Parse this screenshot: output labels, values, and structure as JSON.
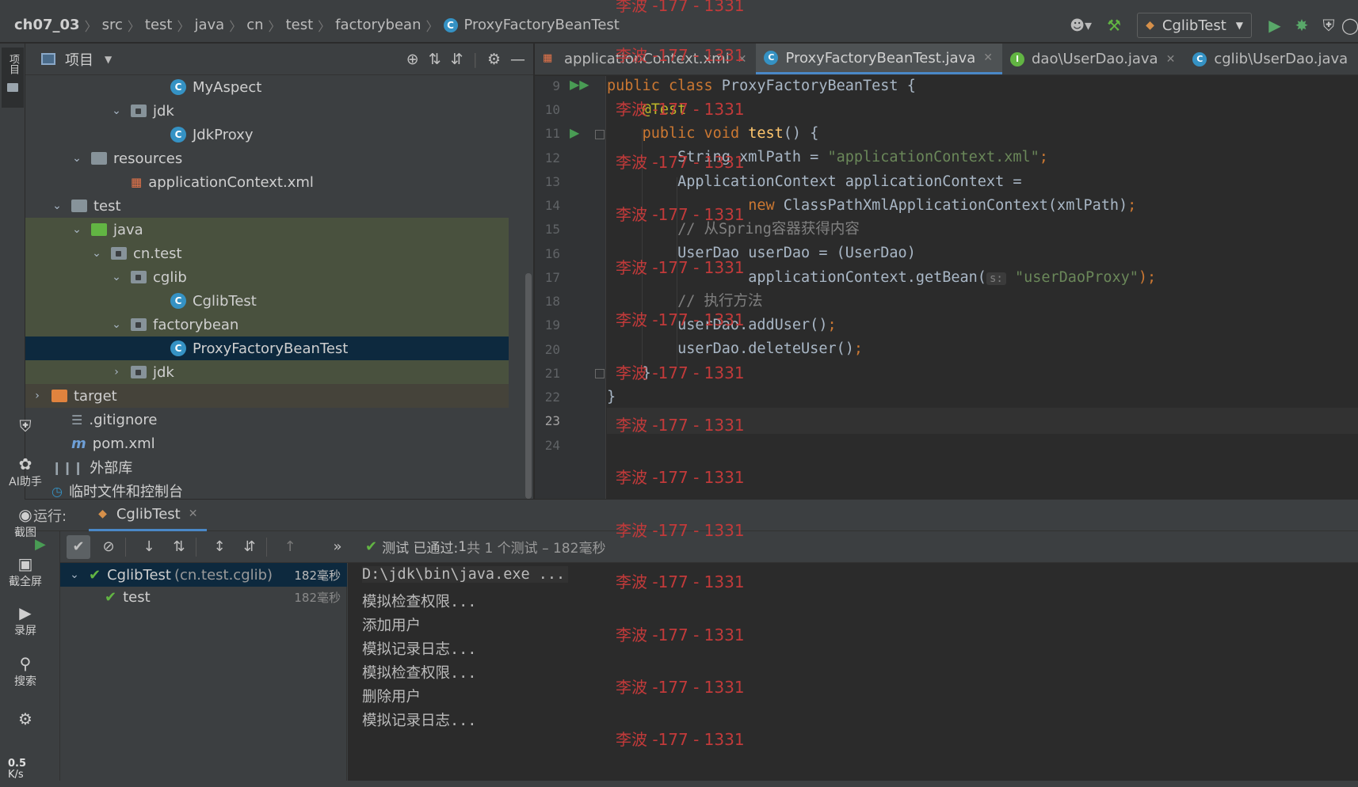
{
  "navbar": {
    "breadcrumbs": [
      "ch07_03",
      "src",
      "test",
      "java",
      "cn",
      "test",
      "factorybean",
      "ProxyFactoryBeanTest"
    ],
    "run_config": "CglibTest"
  },
  "left_strip": {
    "project_tab": "项目"
  },
  "project_panel": {
    "title": "项目",
    "tree": [
      {
        "label": "MyAspect",
        "type": "class",
        "depth": 7
      },
      {
        "label": "jdk",
        "type": "package",
        "depth": 5,
        "open": true
      },
      {
        "label": "JdkProxy",
        "type": "class",
        "depth": 7
      },
      {
        "label": "resources",
        "type": "resources",
        "depth": 3,
        "open": true
      },
      {
        "label": "applicationContext.xml",
        "type": "xml",
        "depth": 5
      },
      {
        "label": "test",
        "type": "folder",
        "depth": 2,
        "open": true
      },
      {
        "label": "java",
        "type": "testroot",
        "depth": 3,
        "open": true
      },
      {
        "label": "cn.test",
        "type": "package",
        "depth": 4,
        "open": true
      },
      {
        "label": "cglib",
        "type": "package",
        "depth": 5,
        "open": true
      },
      {
        "label": "CglibTest",
        "type": "class",
        "depth": 7
      },
      {
        "label": "factorybean",
        "type": "package",
        "depth": 5,
        "open": true
      },
      {
        "label": "ProxyFactoryBeanTest",
        "type": "class",
        "depth": 7,
        "selected": true
      },
      {
        "label": "jdk",
        "type": "package",
        "depth": 5,
        "open": false
      },
      {
        "label": "target",
        "type": "excluded",
        "depth": 1,
        "open": false
      },
      {
        "label": ".gitignore",
        "type": "file",
        "depth": 2
      },
      {
        "label": "pom.xml",
        "type": "maven",
        "depth": 2
      },
      {
        "label": "外部库",
        "type": "libs",
        "depth": 1
      },
      {
        "label": "临时文件和控制台",
        "type": "scratch",
        "depth": 1
      }
    ]
  },
  "editor": {
    "tabs": [
      {
        "label": "applicationContext.xml",
        "icon": "xml-icon",
        "active": false
      },
      {
        "label": "ProxyFactoryBeanTest.java",
        "icon": "class-icon",
        "active": true
      },
      {
        "label": "dao\\UserDao.java",
        "icon": "interface-icon",
        "active": false
      },
      {
        "label": "cglib\\UserDao.java",
        "icon": "class-icon",
        "active": false
      }
    ],
    "line_numbers": [
      "9",
      "10",
      "11",
      "12",
      "13",
      "14",
      "15",
      "16",
      "17",
      "18",
      "19",
      "20",
      "21",
      "22",
      "23",
      "24"
    ],
    "current_line": "23",
    "code": {
      "l9_kw": "public class ",
      "l9_name": "ProxyFactoryBeanTest {",
      "l10": "@Test",
      "l11_kw": "public void ",
      "l11_fn": "test",
      "l11_rest": "() {",
      "l12_a": "String xmlPath = ",
      "l12_str": "\"applicationContext.xml\"",
      "l12_end": ";",
      "l13": "ApplicationContext applicationContext =",
      "l14_kw": "new ",
      "l14_rest": "ClassPathXmlApplicationContext(xmlPath)",
      "l14_end": ";",
      "l15": "// 从Spring容器获得内容",
      "l16": "UserDao userDao = (UserDao)",
      "l17_a": "applicationContext.getBean(",
      "l17_hint": "s:",
      "l17_str": "\"userDaoProxy\"",
      "l17_end": ");",
      "l18": "// 执行方法",
      "l19_a": "userDao.addUser()",
      "l19_end": ";",
      "l20_a": "userDao.deleteUser()",
      "l20_end": ";",
      "l21": "}",
      "l22": "}"
    }
  },
  "run_panel": {
    "label": "运行:",
    "tab": "CglibTest",
    "status_pre": "测试 已通过: ",
    "status_count": "1",
    "status_post": "共 1 个测试 – 182毫秒",
    "test_tree": [
      {
        "label": "CglibTest",
        "detail": "(cn.test.cglib)",
        "time": "182毫秒"
      },
      {
        "label": "test",
        "detail": "",
        "time": "182毫秒"
      }
    ],
    "console": [
      "D:\\jdk\\bin\\java.exe ...",
      "模拟检查权限...",
      "添加用户",
      "模拟记录日志...",
      "模拟检查权限...",
      "删除用户",
      "模拟记录日志..."
    ]
  },
  "assistant": {
    "items": [
      "AI助手",
      "截图",
      "截全屏",
      "录屏",
      "搜索"
    ],
    "speed_value": "0.5",
    "speed_unit": "K/s"
  },
  "watermark": "李波 -177 - 1331",
  "colors": {
    "accent": "#4a88c7",
    "selection": "#0d293e",
    "success": "#62b543",
    "keyword": "#cc7832",
    "string": "#6a8759",
    "annotation": "#bbb529",
    "watermark": "#c23a3a"
  }
}
